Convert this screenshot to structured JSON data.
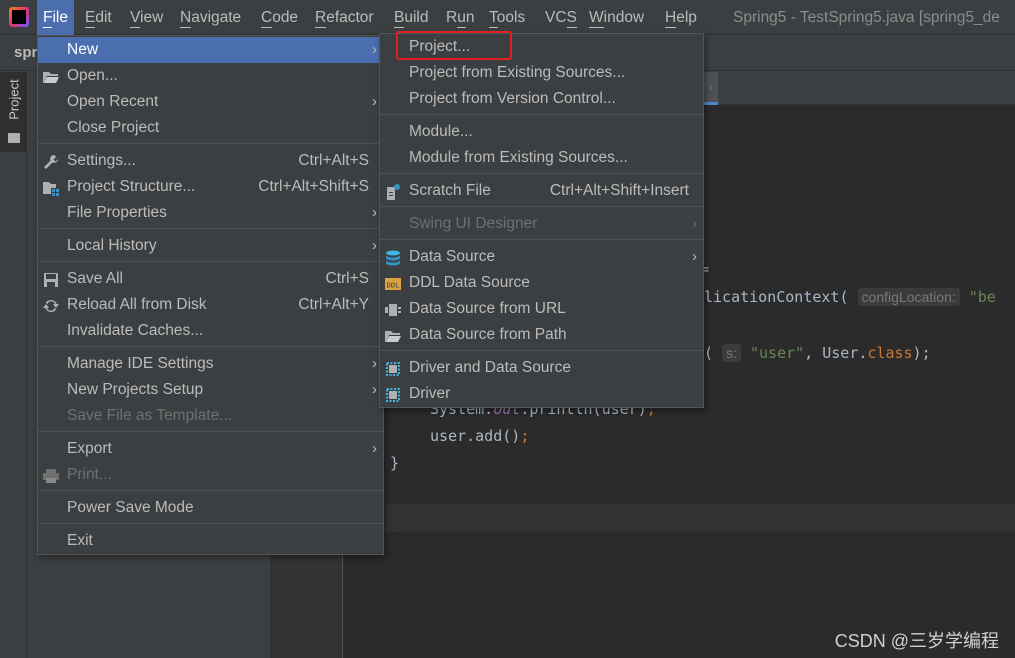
{
  "app": {
    "window_title": "Spring5 - TestSpring5.java [spring5_de",
    "breadcrumb": "spr",
    "project_tab": "Project"
  },
  "menubar": [
    {
      "label": "File",
      "mn": "F",
      "rest": "ile",
      "active": true
    },
    {
      "label": "Edit",
      "mn": "E",
      "rest": "dit"
    },
    {
      "label": "View",
      "mn": "V",
      "rest": "iew"
    },
    {
      "label": "Navigate",
      "mn": "N",
      "rest": "avigate"
    },
    {
      "label": "Code",
      "mn": "C",
      "rest": "ode"
    },
    {
      "label": "Refactor",
      "mn": "R",
      "rest": "efactor"
    },
    {
      "label": "Build",
      "mn": "B",
      "rest": "uild"
    },
    {
      "label": "Run",
      "pre": "R",
      "mn": "u",
      "rest": "n"
    },
    {
      "label": "Tools",
      "mn": "T",
      "rest": "ools"
    },
    {
      "label": "VCS",
      "pre": "VC",
      "mn": "S",
      "rest": ""
    },
    {
      "label": "Window",
      "mn": "W",
      "rest": "indow"
    },
    {
      "label": "Help",
      "mn": "H",
      "rest": "elp"
    }
  ],
  "file_menu": [
    {
      "label": "New",
      "arrow": true,
      "selected": true
    },
    {
      "label": "Open...",
      "icon": "folder-open-icon"
    },
    {
      "label": "Open Recent",
      "arrow": true
    },
    {
      "label": "Close Project"
    },
    {
      "sep": true
    },
    {
      "label": "Settings...",
      "shortcut": "Ctrl+Alt+S",
      "icon": "wrench-icon"
    },
    {
      "label": "Project Structure...",
      "shortcut": "Ctrl+Alt+Shift+S",
      "icon": "project-structure-icon"
    },
    {
      "label": "File Properties",
      "arrow": true
    },
    {
      "sep": true
    },
    {
      "label": "Local History",
      "arrow": true
    },
    {
      "sep": true
    },
    {
      "label": "Save All",
      "shortcut": "Ctrl+S",
      "icon": "save-icon"
    },
    {
      "label": "Reload All from Disk",
      "shortcut": "Ctrl+Alt+Y",
      "icon": "reload-icon"
    },
    {
      "label": "Invalidate Caches..."
    },
    {
      "sep": true
    },
    {
      "label": "Manage IDE Settings",
      "arrow": true
    },
    {
      "label": "New Projects Setup",
      "arrow": true
    },
    {
      "label": "Save File as Template...",
      "disabled": true
    },
    {
      "sep": true
    },
    {
      "label": "Export",
      "arrow": true
    },
    {
      "label": "Print...",
      "disabled": true,
      "icon": "print-icon"
    },
    {
      "sep": true
    },
    {
      "label": "Power Save Mode"
    },
    {
      "sep": true
    },
    {
      "label": "Exit"
    }
  ],
  "new_submenu": [
    {
      "label": "Project..."
    },
    {
      "label": "Project from Existing Sources..."
    },
    {
      "label": "Project from Version Control..."
    },
    {
      "sep": true
    },
    {
      "label": "Module..."
    },
    {
      "label": "Module from Existing Sources..."
    },
    {
      "sep": true
    },
    {
      "label": "Scratch File",
      "shortcut": "Ctrl+Alt+Shift+Insert",
      "icon": "scratch-file-icon"
    },
    {
      "sep": true
    },
    {
      "label": "Swing UI Designer",
      "arrow": true,
      "disabled": true
    },
    {
      "sep": true
    },
    {
      "label": "Data Source",
      "arrow": true,
      "icon": "database-icon"
    },
    {
      "label": "DDL Data Source",
      "icon": "ddl-icon"
    },
    {
      "label": "Data Source from URL",
      "icon": "url-datasource-icon"
    },
    {
      "label": "Data Source from Path",
      "icon": "folder-open-icon"
    },
    {
      "sep": true
    },
    {
      "label": "Driver and Data Source",
      "icon": "driver-icon"
    },
    {
      "label": "Driver",
      "icon": "driver-icon"
    }
  ],
  "code": {
    "line1": "=",
    "line2_a": "licationContext(",
    "line2_hint": "configLocation:",
    "line2_b": "\"be",
    "line3_a": "(",
    "line3_hint": "s:",
    "line3_str": "\"user\"",
    "line3_b": ", User.",
    "line3_kw": "class",
    "line3_c": ");",
    "line4_a": "System.",
    "line4_fld": "out",
    "line4_b": ".println(user)",
    "line4_semi": ";",
    "line5_a": "user.add()",
    "line5_semi": ";",
    "line6": "}"
  },
  "highlight": {
    "color": "#e02020",
    "target": "Project..."
  },
  "watermark": "CSDN @三岁学编程",
  "colors": {
    "accent": "#4b6eaf",
    "menu_bg": "#3c3f41",
    "editor_bg": "#2b2b2b"
  }
}
